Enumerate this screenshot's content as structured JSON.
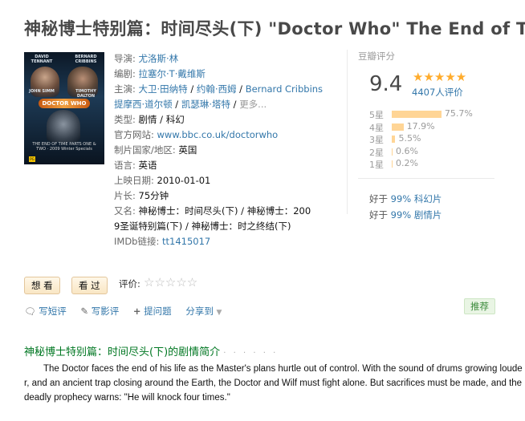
{
  "page_title": "神秘博士特别篇：时间尽头(下) \"Doctor Who\" The End of Time",
  "poster": {
    "names_top": [
      "DAVID TENNANT",
      "BERNARD CRIBBINS",
      "JOHN SIMM",
      "TIMOTHY DALTON"
    ],
    "logo": "DOCTOR WHO",
    "bottom_text": "THE END OF TIME PARTS ONE & TWO · 2009 Winter Specials",
    "rating_badge": "PG"
  },
  "info": {
    "director_label": "导演:",
    "director": "尤洛斯·林",
    "writer_label": "编剧:",
    "writer": "拉塞尔·T·戴维斯",
    "cast_label": "主演:",
    "cast": [
      "大卫·田纳特",
      "约翰·西姆",
      "Bernard Cribbins",
      "提摩西·道尔顿",
      "凯瑟琳·塔特"
    ],
    "cast_more": "更多...",
    "genre_label": "类型:",
    "genre": "剧情 / 科幻",
    "website_label": "官方网站:",
    "website": "www.bbc.co.uk/doctorwho",
    "country_label": "制片国家/地区:",
    "country": "英国",
    "language_label": "语言:",
    "language": "英语",
    "release_label": "上映日期:",
    "release": "2010-01-01",
    "runtime_label": "片长:",
    "runtime": "75分钟",
    "aka_label": "又名:",
    "aka_line1": "神秘博士：时间尽头(下) / 神秘博士：200",
    "aka_line2": "9圣诞特别篇(下) / 神秘博士：时之终结(下)",
    "imdb_label": "IMDb链接:",
    "imdb": "tt1415017"
  },
  "rating": {
    "header": "豆瓣评分",
    "score": "9.4",
    "stars": "★★★★★",
    "count": "4407人评价",
    "distribution": [
      {
        "label": "5星",
        "pct": "75.7%",
        "value": 75.7
      },
      {
        "label": "4星",
        "pct": "17.9%",
        "value": 17.9
      },
      {
        "label": "3星",
        "pct": "5.5%",
        "value": 5.5
      },
      {
        "label": "2星",
        "pct": "0.6%",
        "value": 0.6
      },
      {
        "label": "1星",
        "pct": "0.2%",
        "value": 0.2
      }
    ],
    "better_than": [
      {
        "prefix": "好于",
        "value": "99% 科幻片"
      },
      {
        "prefix": "好于",
        "value": "99% 剧情片"
      }
    ]
  },
  "buttons": {
    "want": "想 看",
    "watched": "看 过",
    "rate_label": "评价:",
    "rate_stars": "☆☆☆☆☆"
  },
  "actions": {
    "short_review": "写短评",
    "review": "写影评",
    "question": "提问题",
    "share": "分享到",
    "recommend": "推荐"
  },
  "synopsis": {
    "title": "神秘博士特别篇：时间尽头(下)的剧情简介",
    "dots": "· · · · · ·",
    "text": "The Doctor faces the end of his life as the Master's plans hurtle out of control. With the sound of drums growing louder, and an ancient trap closing around the Earth, the Doctor and Wilf must fight alone. But sacrifices must be made, and the deadly prophecy warns: \"He will knock four times.\""
  },
  "colors": {
    "link": "#3377aa",
    "accent_green": "#007722",
    "star": "#ffac2d",
    "bar": "#ffd596"
  }
}
